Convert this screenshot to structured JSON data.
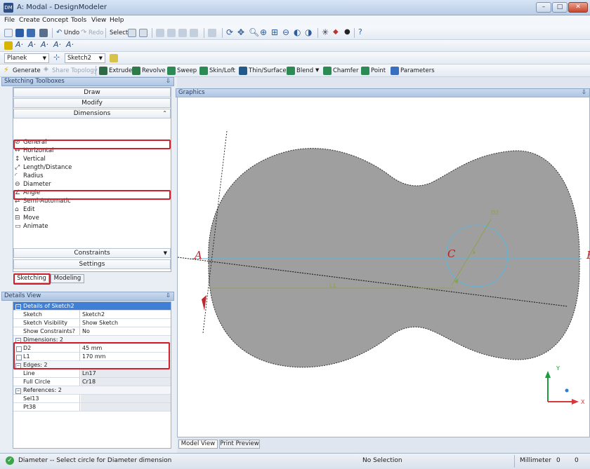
{
  "window": {
    "title": "A: Modal - DesignModeler",
    "icon": "app-logo-icon",
    "controls": [
      "–",
      "□",
      "✕"
    ]
  },
  "menubar": [
    "File",
    "Create",
    "Concept",
    "Tools",
    "View",
    "Help"
  ],
  "toolbar1": {
    "undo": "Undo",
    "redo": "Redo",
    "select": "Select"
  },
  "toolbar3": {
    "plane": "Planek",
    "sketch": "Sketch2"
  },
  "toolbar4": {
    "generate": "Generate",
    "share_topology": "Share Topology",
    "extrude": "Extrude",
    "revolve": "Revolve",
    "sweep": "Sweep",
    "skin_loft": "Skin/Loft",
    "thin_surface": "Thin/Surface",
    "blend": "Blend",
    "chamfer": "Chamfer",
    "point": "Point",
    "parameters": "Parameters"
  },
  "sketching_toolboxes": {
    "title": "Sketching Toolboxes",
    "pin": "⇩",
    "draw": "Draw",
    "modify": "Modify",
    "dimensions": "Dimensions",
    "tools": [
      "General",
      "Horizontal",
      "Vertical",
      "Length/Distance",
      "Radius",
      "Diameter",
      "Angle",
      "Semi-Automatic",
      "Edit",
      "Move",
      "Animate"
    ],
    "constraints": "Constraints",
    "settings": "Settings"
  },
  "mode_tabs": {
    "sketching": "Sketching",
    "modeling": "Modeling"
  },
  "details_view": {
    "title": "Details View",
    "pin": "⇩",
    "header": "Details of Sketch2",
    "rows": [
      {
        "k": "Sketch",
        "v": "Sketch2"
      },
      {
        "k": "Sketch Visibility",
        "v": "Show Sketch"
      },
      {
        "k": "Show Constraints?",
        "v": "No"
      }
    ],
    "dimensions_group": "Dimensions: 2",
    "dimensions": [
      {
        "k": "D2",
        "v": "45 mm"
      },
      {
        "k": "L1",
        "v": "170 mm"
      }
    ],
    "edges_group": "Edges: 2",
    "edges": [
      {
        "k": "Line",
        "v": "Ln17"
      },
      {
        "k": "Full Circle",
        "v": "Cr18"
      }
    ],
    "references_group": "References: 2",
    "references": [
      {
        "k": "Sel13",
        "v": ""
      },
      {
        "k": "Pt38",
        "v": ""
      }
    ]
  },
  "graphics": {
    "title": "Graphics",
    "pin": "⇩",
    "label_a": "A",
    "label_b": "B",
    "label_c": "C",
    "dim_d2": "D2",
    "dim_l1": "L1",
    "axis_y": "Y",
    "axis_x": "X",
    "tabs": {
      "model_view": "Model View",
      "print_preview": "Print Preview"
    },
    "colors": {
      "body": "#9f9f9f",
      "triad_y": "#1f9a3e",
      "triad_x": "#d43a3a",
      "dim": "#8fa04a"
    }
  },
  "status": {
    "message": "Diameter -- Select circle for Diameter dimension",
    "selection": "No Selection",
    "units": "Millimeter",
    "value1": "0",
    "value2": "0"
  }
}
